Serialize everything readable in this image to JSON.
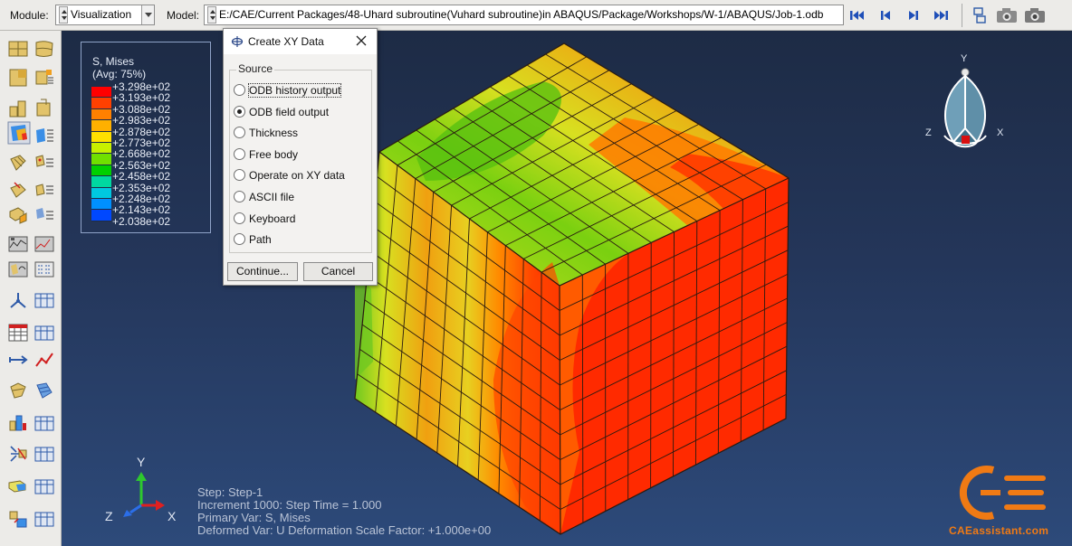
{
  "toolbar": {
    "module_label": "Module:",
    "module_value": "Visualization",
    "model_label": "Model:",
    "model_value": "E:/CAE/Current Packages/48-Uhard  subroutine(Vuhard  subroutine)in ABAQUS/Package/Workshops/W-1/ABAQUS/Job-1.odb",
    "nav_icons": [
      "first-frame-icon",
      "previous-frame-icon",
      "next-frame-icon",
      "last-frame-icon"
    ],
    "extra_icons": [
      "animation-options-icon",
      "camera-icon",
      "screenshot-icon"
    ]
  },
  "legend": {
    "title_line1": "S, Mises",
    "title_line2": "(Avg: 75%)",
    "values": [
      "+3.298e+02",
      "+3.193e+02",
      "+3.088e+02",
      "+2.983e+02",
      "+2.878e+02",
      "+2.773e+02",
      "+2.668e+02",
      "+2.563e+02",
      "+2.458e+02",
      "+2.353e+02",
      "+2.248e+02",
      "+2.143e+02",
      "+2.038e+02"
    ],
    "colors": [
      "#ff0000",
      "#ff4000",
      "#ff8000",
      "#ffb000",
      "#ffe000",
      "#c8f000",
      "#70e000",
      "#00d000",
      "#00d8a0",
      "#00c8e0",
      "#0090ff",
      "#0048ff",
      "#0000ff"
    ]
  },
  "dialog": {
    "title": "Create XY Data",
    "group_label": "Source",
    "options": [
      {
        "label": "ODB history output",
        "selected": false
      },
      {
        "label": "ODB field output",
        "selected": true
      },
      {
        "label": "Thickness",
        "selected": false
      },
      {
        "label": "Free body",
        "selected": false
      },
      {
        "label": "Operate on XY data",
        "selected": false
      },
      {
        "label": "ASCII file",
        "selected": false
      },
      {
        "label": "Keyboard",
        "selected": false
      },
      {
        "label": "Path",
        "selected": false
      }
    ],
    "continue_label": "Continue...",
    "cancel_label": "Cancel"
  },
  "view_triad": {
    "y": "Y",
    "z": "Z",
    "x": "X"
  },
  "axis_triad": {
    "y": "Y",
    "z": "Z",
    "x": "X"
  },
  "status": {
    "step": "Step: Step-1",
    "increment": "Increment    1000: Step Time =     1.000",
    "primary_var": "Primary Var: S, Mises",
    "deformed_var": "Deformed Var: U   Deformation Scale Factor: +1.000e+00"
  },
  "watermark": {
    "text": "CAEassistant.com",
    "color": "#f07a14"
  }
}
